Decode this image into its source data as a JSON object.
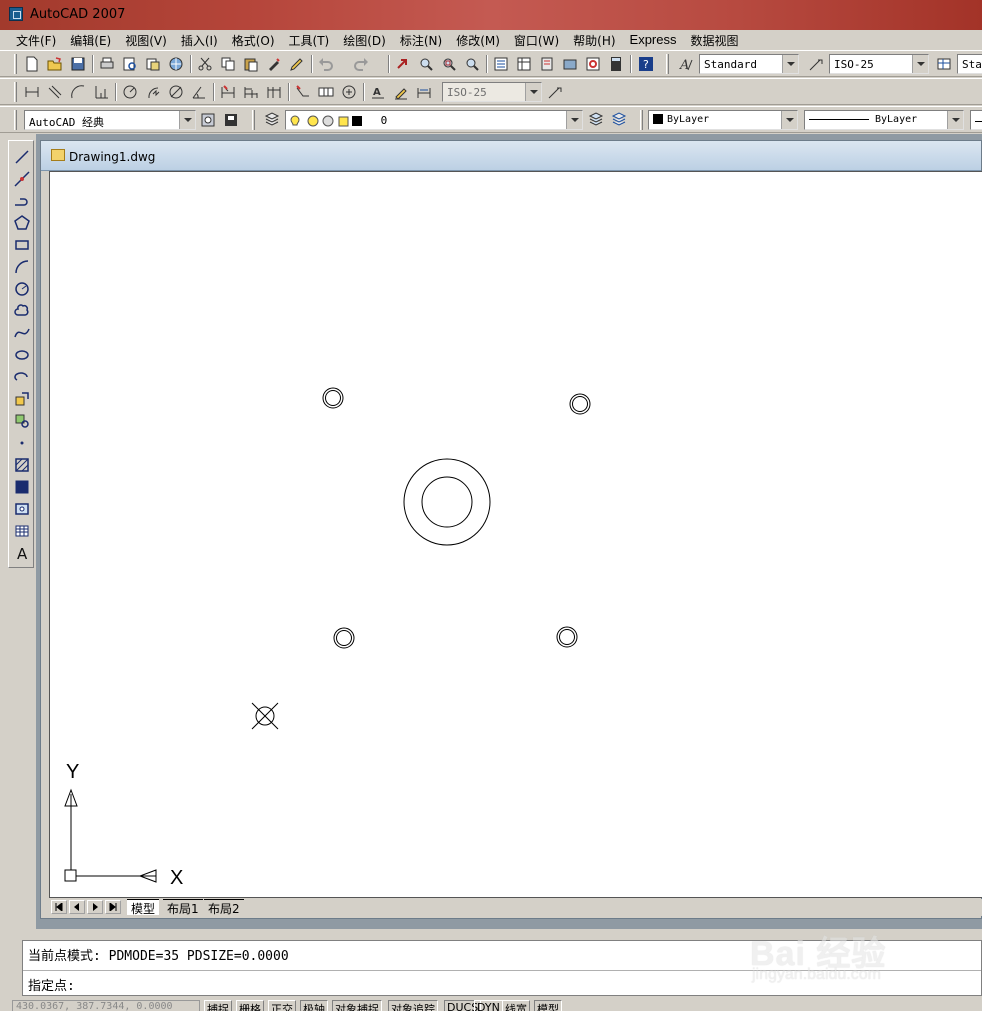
{
  "window": {
    "title": "AutoCAD 2007"
  },
  "menu": [
    "文件(F)",
    "编辑(E)",
    "视图(V)",
    "插入(I)",
    "格式(O)",
    "工具(T)",
    "绘图(D)",
    "标注(N)",
    "修改(M)",
    "窗口(W)",
    "帮助(H)",
    "Express",
    "数据视图"
  ],
  "styles_toolbar": {
    "text_style": "Standard",
    "dim_style": "ISO-25",
    "table_style": "Sta"
  },
  "dim_toolbar": {
    "dim_style": "ISO-25"
  },
  "workspace": {
    "name": "AutoCAD 经典"
  },
  "layers": {
    "current_layer": "0"
  },
  "properties": {
    "color": "ByLayer",
    "linetype": "ByLayer"
  },
  "document": {
    "name": "Drawing1.dwg"
  },
  "ucs": {
    "x_label": "X",
    "y_label": "Y"
  },
  "layout_tabs": [
    "模型",
    "布局1",
    "布局2"
  ],
  "command": {
    "history": "当前点模式:  PDMODE=35  PDSIZE=0.0000",
    "prompt": "指定点:"
  },
  "statusbar": {
    "coords": "430.0367, 387.7344, 0.0000",
    "toggles": [
      {
        "label": "捕捉",
        "on": false
      },
      {
        "label": "栅格",
        "on": false
      },
      {
        "label": "正交",
        "on": false
      },
      {
        "label": "极轴",
        "on": true
      },
      {
        "label": "对象捕捉",
        "on": true
      },
      {
        "label": "对象追踪",
        "on": true
      },
      {
        "label": "DUCS",
        "on": true
      },
      {
        "label": "DYN",
        "on": false
      },
      {
        "label": "线宽",
        "on": false
      },
      {
        "label": "模型",
        "on": true
      }
    ]
  },
  "watermark": {
    "main": "Bai 经验",
    "sub": "jingyan.baidu.com"
  },
  "colors": {
    "title_bar": "#b5453a",
    "chrome": "#d4d0c8",
    "canvas": "#ffffff"
  }
}
